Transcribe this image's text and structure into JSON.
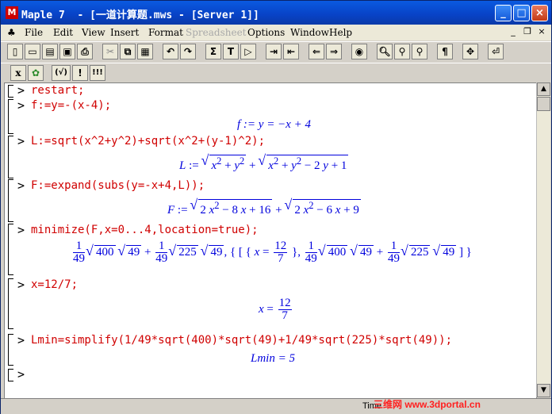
{
  "window": {
    "title": "Maple 7  - [一道计算题.mws - [Server 1]]",
    "app_icon": "M"
  },
  "menu": [
    "File",
    "Edit",
    "View",
    "Insert",
    "Format",
    "Spreadsheet",
    "Options",
    "Window",
    "Help"
  ],
  "toolbar1": [
    "new-icon",
    "open-icon",
    "open-server-icon",
    "save-icon",
    "print-icon",
    "cut-icon",
    "copy-icon",
    "paste-icon",
    "undo-icon",
    "redo-icon",
    "sum-icon",
    "text-icon",
    "prompt-icon",
    "indent-icon",
    "outdent-icon",
    "back-icon",
    "forward-icon",
    "stop-icon",
    "zoom-1-icon",
    "zoom-2-icon",
    "zoom-3-icon",
    "paragraph-icon",
    "expand-icon",
    "restart-icon"
  ],
  "toolbar2": {
    "x_btn": "x",
    "fraction": "(√)",
    "excl": "!",
    "triple_excl": "!!!"
  },
  "worksheet": {
    "in1": "restart;",
    "in2": "f:=y=-(x-4);",
    "out2": "f := y = −x + 4",
    "in3": "L:=sqrt(x^2+y^2)+sqrt(x^2+(y-1)^2);",
    "in4": "F:=expand(subs(y=-x+4,L));",
    "in5": "minimize(F,x=0...4,location=true);",
    "in6": "x=12/7;",
    "in7": "Lmin=simplify(1/49*sqrt(400)*sqrt(49)+1/49*sqrt(225)*sqrt(49));",
    "out7": "Lmin = 5",
    "prompt": ">"
  },
  "status": {
    "time_label": "Time"
  },
  "watermark": "三维网 www.3dportal.cn"
}
